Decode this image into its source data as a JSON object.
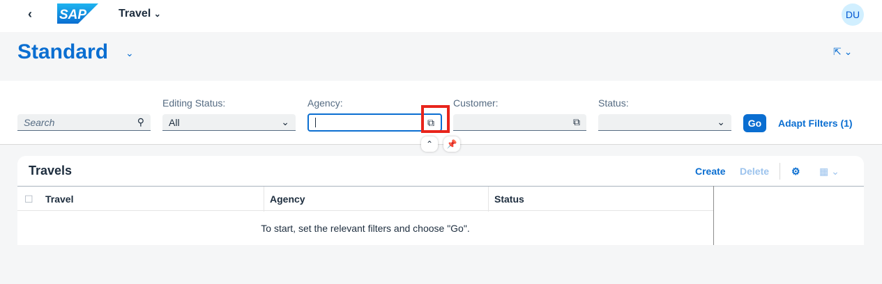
{
  "shell": {
    "back_icon": "chevron-left",
    "app_title": "Travel",
    "avatar": "DU",
    "logo": "SAP"
  },
  "page": {
    "variant": "Standard"
  },
  "filters": {
    "search_placeholder": "Search",
    "editing_status": {
      "label": "Editing Status:",
      "value": "All"
    },
    "agency": {
      "label": "Agency:",
      "value": ""
    },
    "customer": {
      "label": "Customer:",
      "value": ""
    },
    "status": {
      "label": "Status:",
      "value": ""
    },
    "go": "Go",
    "adapt": "Adapt Filters (1)"
  },
  "table": {
    "title": "Travels",
    "create": "Create",
    "delete": "Delete",
    "columns": [
      "Travel",
      "Agency",
      "Status"
    ],
    "empty_text": "To start, set the relevant filters and choose \"Go\"."
  },
  "colors": {
    "accent": "#0a6ed1",
    "highlight": "#e8251c"
  }
}
